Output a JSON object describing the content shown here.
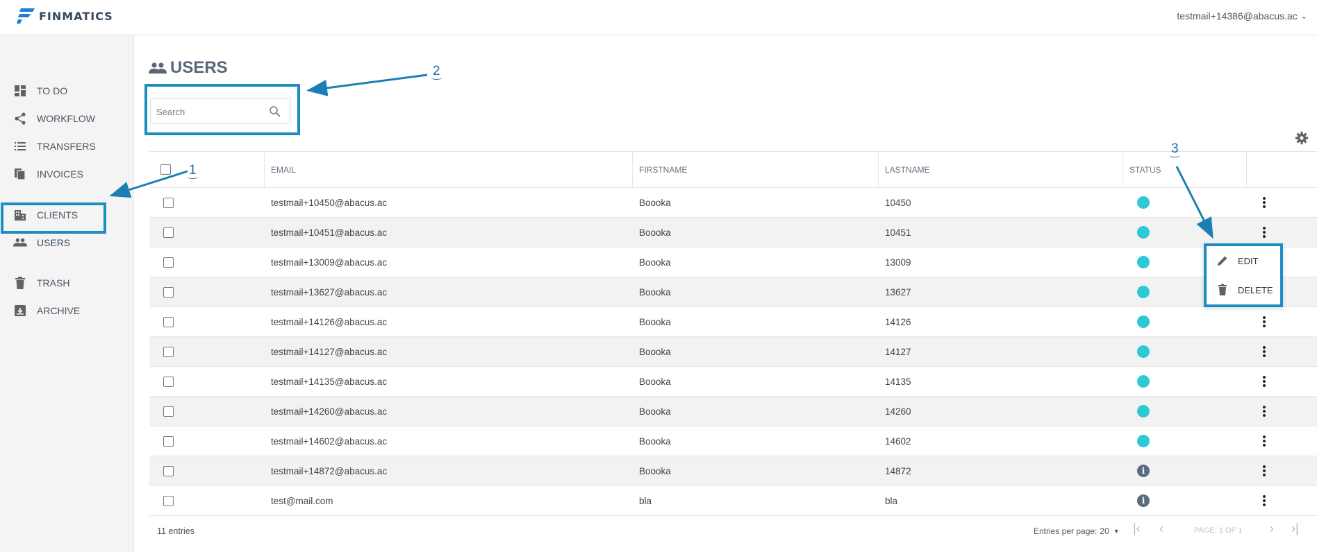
{
  "app": {
    "brand": "FINMATICS",
    "account": "testmail+14386@abacus.ac"
  },
  "sidebar": {
    "items": [
      {
        "label": "TO DO",
        "icon": "dashboard-icon"
      },
      {
        "label": "WORKFLOW",
        "icon": "share-icon"
      },
      {
        "label": "TRANSFERS",
        "icon": "list-icon"
      },
      {
        "label": "INVOICES",
        "icon": "documents-icon"
      },
      {
        "label": "CLIENTS",
        "icon": "building-icon"
      },
      {
        "label": "USERS",
        "icon": "people-icon",
        "active": true
      },
      {
        "label": "TRASH",
        "icon": "trash-icon"
      },
      {
        "label": "ARCHIVE",
        "icon": "archive-icon"
      }
    ]
  },
  "page": {
    "title": "USERS",
    "search_placeholder": "Search"
  },
  "table": {
    "columns": [
      "EMAIL",
      "FIRSTNAME",
      "LASTNAME",
      "STATUS"
    ],
    "rows": [
      {
        "email": "testmail+10450@abacus.ac",
        "firstname": "Boooka",
        "lastname": "10450",
        "status": "active"
      },
      {
        "email": "testmail+10451@abacus.ac",
        "firstname": "Boooka",
        "lastname": "10451",
        "status": "active"
      },
      {
        "email": "testmail+13009@abacus.ac",
        "firstname": "Boooka",
        "lastname": "13009",
        "status": "active"
      },
      {
        "email": "testmail+13627@abacus.ac",
        "firstname": "Boooka",
        "lastname": "13627",
        "status": "active"
      },
      {
        "email": "testmail+14126@abacus.ac",
        "firstname": "Boooka",
        "lastname": "14126",
        "status": "active"
      },
      {
        "email": "testmail+14127@abacus.ac",
        "firstname": "Boooka",
        "lastname": "14127",
        "status": "active"
      },
      {
        "email": "testmail+14135@abacus.ac",
        "firstname": "Boooka",
        "lastname": "14135",
        "status": "active"
      },
      {
        "email": "testmail+14260@abacus.ac",
        "firstname": "Boooka",
        "lastname": "14260",
        "status": "active"
      },
      {
        "email": "testmail+14602@abacus.ac",
        "firstname": "Boooka",
        "lastname": "14602",
        "status": "active"
      },
      {
        "email": "testmail+14872@abacus.ac",
        "firstname": "Boooka",
        "lastname": "14872",
        "status": "info"
      },
      {
        "email": "test@mail.com",
        "firstname": "bla",
        "lastname": "bla",
        "status": "info"
      }
    ]
  },
  "footer": {
    "entries": "11 entries",
    "entries_per_page_label": "Entries per page:",
    "entries_per_page_value": "20",
    "page_info": "PAGE: 1 OF 1"
  },
  "context_menu": {
    "items": [
      {
        "label": "EDIT",
        "icon": "pencil-icon"
      },
      {
        "label": "DELETE",
        "icon": "trash-icon"
      }
    ]
  },
  "annotations": {
    "one": "1",
    "two": "2",
    "three": "3"
  },
  "colors": {
    "accent": "#1c8dc1",
    "status_active": "#2fc9d6",
    "status_info": "#5b6b80"
  }
}
